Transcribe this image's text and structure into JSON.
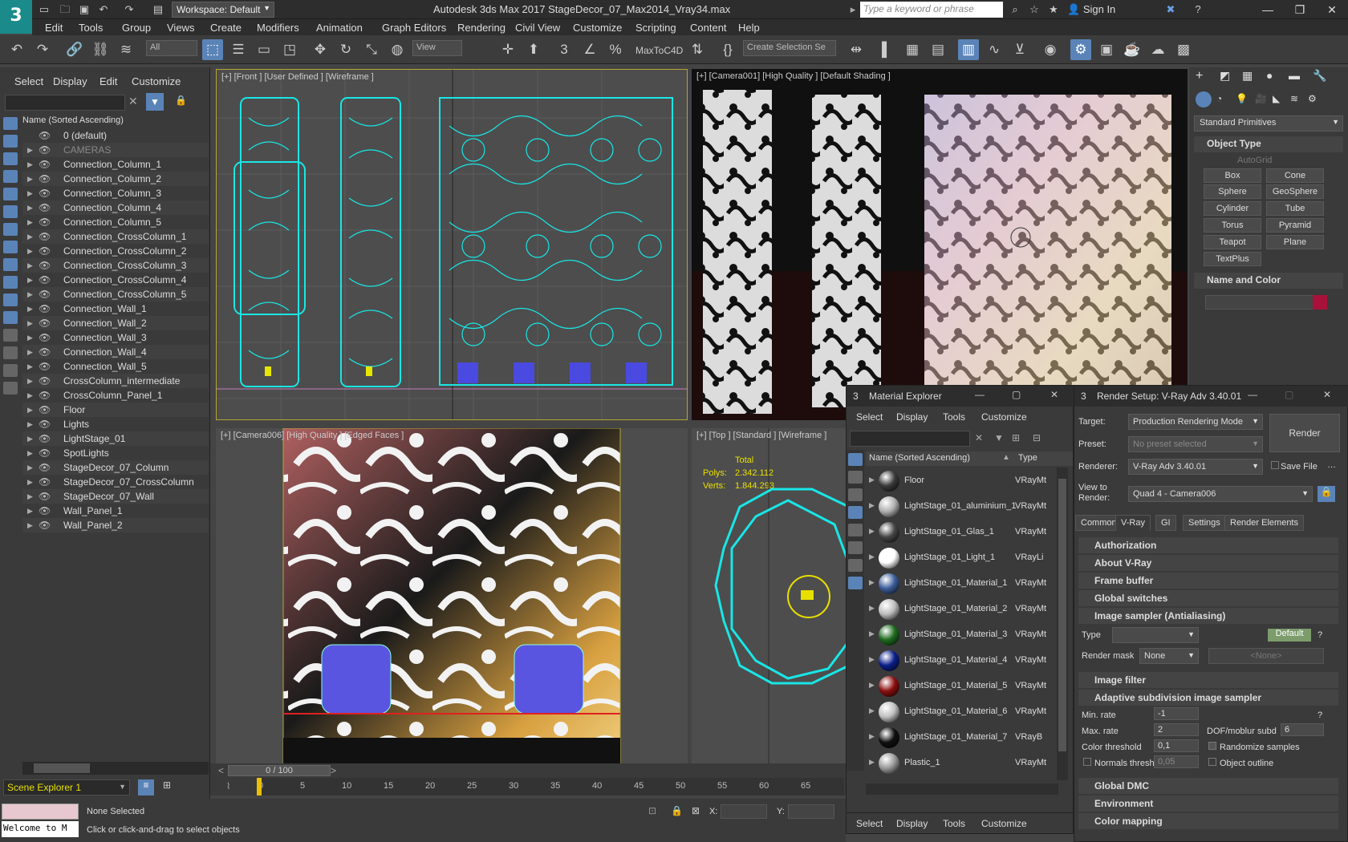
{
  "app": {
    "workspace": "Workspace: Default",
    "title": "Autodesk 3ds Max 2017      StageDecor_07_Max2014_Vray34.max",
    "search_placeholder": "Type a keyword or phrase",
    "sign_in": "Sign In"
  },
  "menu": [
    "Edit",
    "Tools",
    "Group",
    "Views",
    "Create",
    "Modifiers",
    "Animation",
    "Graph Editors",
    "Rendering",
    "Civil View",
    "Customize",
    "Scripting",
    "Content",
    "Help"
  ],
  "toolbar": {
    "filter": "All",
    "view": "View",
    "maxtoc4d": "MaxToC4D",
    "selection_set": "Create Selection Se"
  },
  "scene_explorer": {
    "menu": [
      "Select",
      "Display",
      "Edit",
      "Customize"
    ],
    "header": "Name (Sorted Ascending)",
    "items": [
      "0 (default)",
      "CAMERAS",
      "Connection_Column_1",
      "Connection_Column_2",
      "Connection_Column_3",
      "Connection_Column_4",
      "Connection_Column_5",
      "Connection_CrossColumn_1",
      "Connection_CrossColumn_2",
      "Connection_CrossColumn_3",
      "Connection_CrossColumn_4",
      "Connection_CrossColumn_5",
      "Connection_Wall_1",
      "Connection_Wall_2",
      "Connection_Wall_3",
      "Connection_Wall_4",
      "Connection_Wall_5",
      "CrossColumn_intermediate",
      "CrossColumn_Panel_1",
      "Floor",
      "Lights",
      "LightStage_01",
      "SpotLights",
      "StageDecor_07_Column",
      "StageDecor_07_CrossColumn",
      "StageDecor_07_Wall",
      "Wall_Panel_1",
      "Wall_Panel_2"
    ],
    "footer": "Scene Explorer 1"
  },
  "viewports": {
    "front": "[+] [Front ] [User Defined ] [Wireframe ]",
    "camera001": "[+] [Camera001] [High Quality ] [Default Shading ]",
    "camera006": "[+] [Camera006] [High Quality ] [Edged Faces ]",
    "top": "[+] [Top ] [Standard ] [Wireframe ]",
    "stats": {
      "total": "Total",
      "polys_label": "Polys:",
      "polys": "2.342.112",
      "verts_label": "Verts:",
      "verts": "1.844.293"
    }
  },
  "command_panel": {
    "dropdown": "Standard Primitives",
    "object_type": "Object Type",
    "autogrid": "AutoGrid",
    "buttons": [
      "Box",
      "Cone",
      "Sphere",
      "GeoSphere",
      "Cylinder",
      "Tube",
      "Torus",
      "Pyramid",
      "Teapot",
      "Plane",
      "TextPlus"
    ],
    "name_and_color": "Name and Color",
    "color": "#a8123a"
  },
  "material_explorer": {
    "title": "Material Explorer",
    "menu": [
      "Select",
      "Display",
      "Tools",
      "Customize"
    ],
    "header_name": "Name (Sorted Ascending)",
    "header_type": "Type",
    "items": [
      {
        "name": "Floor",
        "type": "VRayMt",
        "color": "#3a3a3a"
      },
      {
        "name": "LightStage_01_aluminium_1",
        "type": "VRayMt",
        "color": "#b0b0b0"
      },
      {
        "name": "LightStage_01_Glas_1",
        "type": "VRayMt",
        "color": "#444444"
      },
      {
        "name": "LightStage_01_Light_1",
        "type": "VRayLi",
        "color": "#ffffff"
      },
      {
        "name": "LightStage_01_Material_1",
        "type": "VRayMt",
        "color": "#3d5e9a"
      },
      {
        "name": "LightStage_01_Material_2",
        "type": "VRayMt",
        "color": "#bdbdbd"
      },
      {
        "name": "LightStage_01_Material_3",
        "type": "VRayMt",
        "color": "#1f6b1f"
      },
      {
        "name": "LightStage_01_Material_4",
        "type": "VRayMt",
        "color": "#0a1f8a"
      },
      {
        "name": "LightStage_01_Material_5",
        "type": "VRayMt",
        "color": "#8a0f0f"
      },
      {
        "name": "LightStage_01_Material_6",
        "type": "VRayMt",
        "color": "#c0c0c0"
      },
      {
        "name": "LightStage_01_Material_7",
        "type": "VRayB",
        "color": "#101010"
      },
      {
        "name": "Plastic_1",
        "type": "VRayMt",
        "color": "#9a9a9a"
      }
    ],
    "bottom_menu": [
      "Select",
      "Display",
      "Tools",
      "Customize"
    ]
  },
  "render_setup": {
    "title": "Render Setup: V-Ray Adv 3.40.01",
    "target_label": "Target:",
    "target": "Production Rendering Mode",
    "preset_label": "Preset:",
    "preset": "No preset selected",
    "renderer_label": "Renderer:",
    "renderer": "V-Ray Adv 3.40.01",
    "save_file": "Save File",
    "view_label": "View to Render:",
    "view": "Quad 4 - Camera006",
    "render_button": "Render",
    "tabs": [
      "Common",
      "V-Ray",
      "GI",
      "Settings",
      "Render Elements"
    ],
    "sections": [
      "Authorization",
      "About V-Ray",
      "Frame buffer",
      "Global switches",
      "Image sampler (Antialiasing)"
    ],
    "type_label": "Type",
    "default_btn": "Default",
    "render_mask_label": "Render mask",
    "render_mask": "None",
    "none_field": "<None>",
    "image_filter": "Image filter",
    "adaptive": "Adaptive subdivision image sampler",
    "min_rate_label": "Min. rate",
    "min_rate": "-1",
    "max_rate_label": "Max. rate",
    "max_rate": "2",
    "dof_label": "DOF/moblur subd",
    "dof": "6",
    "color_threshold_label": "Color threshold",
    "color_threshold": "0,1",
    "randomize": "Randomize samples",
    "normals_label": "Normals thresh.",
    "normals": "0,05",
    "object_outline": "Object outline",
    "more_sections": [
      "Global DMC",
      "Environment",
      "Color mapping"
    ]
  },
  "timeline": {
    "frame": "0 / 100",
    "ticks": [
      "0",
      "5",
      "10",
      "15",
      "20",
      "25",
      "30",
      "35",
      "40",
      "45",
      "50",
      "55",
      "60",
      "65"
    ]
  },
  "status": {
    "welcome": "Welcome to M",
    "selection": "None Selected",
    "hint": "Click or click-and-drag to select objects",
    "x_label": "X:",
    "y_label": "Y:"
  }
}
